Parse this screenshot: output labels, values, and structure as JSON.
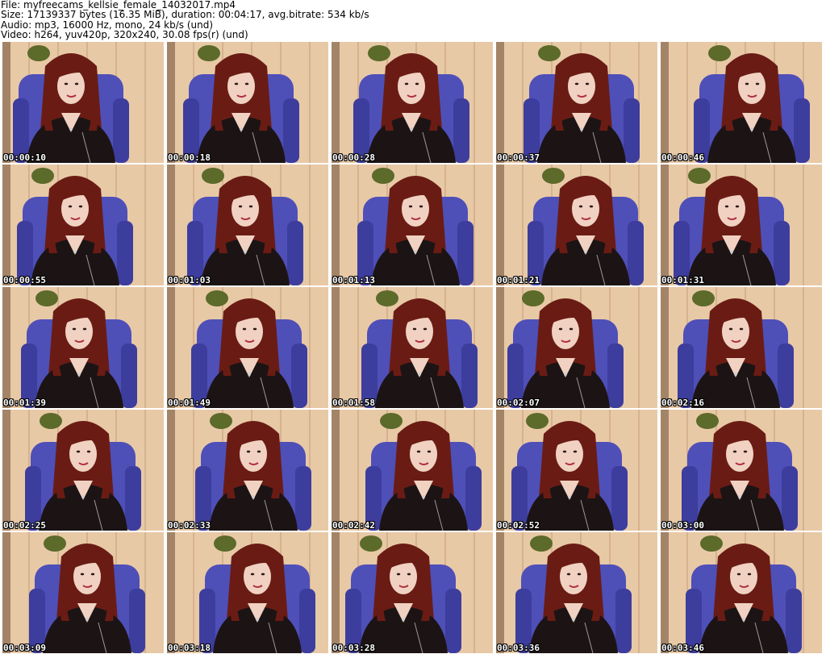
{
  "header": {
    "file": "File: myfreecams_kellsie_female_14032017.mp4",
    "size": "Size: 17139337 bytes (16.35 MiB), duration: 00:04:17, avg.bitrate: 534 kb/s",
    "audio": "Audio: mp3, 16000 Hz, mono, 24 kb/s (und)",
    "video": "Video: h264, yuv420p, 320x240, 30.08 fps(r) (und)"
  },
  "thumbnails": [
    {
      "timestamp": "00:00:10"
    },
    {
      "timestamp": "00:00:18"
    },
    {
      "timestamp": "00:00:28"
    },
    {
      "timestamp": "00:00:37"
    },
    {
      "timestamp": "00:00:46"
    },
    {
      "timestamp": "00:00:55"
    },
    {
      "timestamp": "00:01:03"
    },
    {
      "timestamp": "00:01:13"
    },
    {
      "timestamp": "00:01:21"
    },
    {
      "timestamp": "00:01:31"
    },
    {
      "timestamp": "00:01:39"
    },
    {
      "timestamp": "00:01:49"
    },
    {
      "timestamp": "00:01:58"
    },
    {
      "timestamp": "00:02:07"
    },
    {
      "timestamp": "00:02:16"
    },
    {
      "timestamp": "00:02:25"
    },
    {
      "timestamp": "00:02:33"
    },
    {
      "timestamp": "00:02:42"
    },
    {
      "timestamp": "00:02:52"
    },
    {
      "timestamp": "00:03:00"
    },
    {
      "timestamp": "00:03:09"
    },
    {
      "timestamp": "00:03:18"
    },
    {
      "timestamp": "00:03:28"
    },
    {
      "timestamp": "00:03:36"
    },
    {
      "timestamp": "00:03:46"
    }
  ],
  "colors": {
    "background": "#ffffff",
    "wall": "#e8c9a6",
    "chair": "#4f4fb8",
    "hair": "#6a1c14",
    "jacket": "#1c1414",
    "skin": "#f1d2c2"
  }
}
